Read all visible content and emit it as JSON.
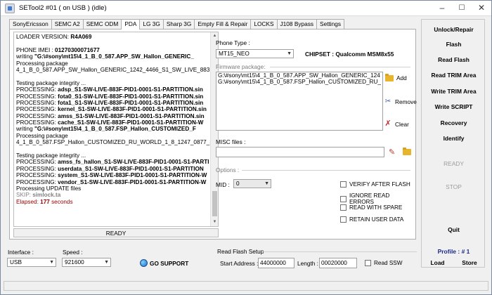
{
  "window": {
    "title": "SETool2 #01 ( on USB ) (idle)"
  },
  "tabs": [
    "SonyEricsson",
    "SEMC A2",
    "SEMC ODM",
    "PDA",
    "LG 3G",
    "Sharp 3G",
    "Empty Fill & Repair",
    "LOCKS",
    "J108 Bypass",
    "Settings"
  ],
  "log": {
    "lines": [
      [
        {
          "t": "LOADER VERSION: "
        },
        {
          "t": "R4A069",
          "c": "b"
        }
      ],
      [],
      [
        {
          "t": "PHONE IMEI : "
        },
        {
          "t": "01270300071677",
          "c": "b"
        }
      ],
      [
        {
          "t": "writing "
        },
        {
          "t": "\"G:\\#sony\\mt15\\4_1_B_0_587.APP_SW_Hallon_GENERIC_",
          "c": "b"
        }
      ],
      [
        {
          "t": "Processing package"
        }
      ],
      [
        {
          "t": "4_1_B_0_587.APP_SW_Hallon_GENERIC_1242_4466_S1_SW_LIVE_883F"
        }
      ],
      [],
      [
        {
          "t": "Testing package integrity ..."
        }
      ],
      [
        {
          "t": "PROCESSING: "
        },
        {
          "t": "adsp_S1-SW-LIVE-883F-PID1-0001-S1-PARTITION.sin",
          "c": "b"
        }
      ],
      [
        {
          "t": "PROCESSING: "
        },
        {
          "t": "fota0_S1-SW-LIVE-883F-PID1-0001-S1-PARTITION.sin",
          "c": "b"
        }
      ],
      [
        {
          "t": "PROCESSING: "
        },
        {
          "t": "fota1_S1-SW-LIVE-883F-PID1-0001-S1-PARTITION.sin",
          "c": "b"
        }
      ],
      [
        {
          "t": "PROCESSING: "
        },
        {
          "t": "kernel_S1-SW-LIVE-883F-PID1-0001-S1-PARTITION.sin",
          "c": "b"
        }
      ],
      [
        {
          "t": "PROCESSING: "
        },
        {
          "t": "amss_S1-SW-LIVE-883F-PID1-0001-S1-PARTITION.sin",
          "c": "b"
        }
      ],
      [
        {
          "t": "PROCESSING: "
        },
        {
          "t": "cache_S1-SW-LIVE-883F-PID1-0001-S1-PARTITION-W",
          "c": "b"
        }
      ],
      [
        {
          "t": "writing "
        },
        {
          "t": "\"G:\\#sony\\mt15\\4_1_B_0_587.FSP_Hallon_CUSTOMIZED_F",
          "c": "b"
        }
      ],
      [
        {
          "t": "Processing package"
        }
      ],
      [
        {
          "t": "4_1_B_0_587.FSP_Hallon_CUSTOMIZED_RU_WORLD_1_8_1247_0877_S1"
        }
      ],
      [],
      [
        {
          "t": "Testing package integrity ..."
        }
      ],
      [
        {
          "t": "PROCESSING: "
        },
        {
          "t": "amss_fs_hallon_S1-SW-LIVE-883F-PID1-0001-S1-PARTI",
          "c": "b"
        }
      ],
      [
        {
          "t": "PROCESSING: "
        },
        {
          "t": "userdata_S1-SW-LIVE-883F-PID1-0001-S1-PARTITION",
          "c": "b"
        }
      ],
      [
        {
          "t": "PROCESSING: "
        },
        {
          "t": "system_S1-SW-LIVE-883F-PID1-0001-S1-PARTITION-W",
          "c": "b"
        }
      ],
      [
        {
          "t": "PROCESSING: "
        },
        {
          "t": "vendor_S1-SW-LIVE-883F-PID1-0001-S1-PARTITION-W",
          "c": "b"
        }
      ],
      [
        {
          "t": "Processing UPDATE files"
        }
      ],
      [
        {
          "t": "SKIP: ",
          "c": "gray"
        },
        {
          "t": "simlock.ta",
          "c": "gray b"
        }
      ],
      [
        {
          "t": "Elapsed: ",
          "c": "red"
        },
        {
          "t": "177",
          "c": "red b"
        },
        {
          "t": " seconds",
          "c": "red"
        }
      ]
    ],
    "status": "READY"
  },
  "phone_type": {
    "label": "Phone Type :",
    "value": "MT15_NEO"
  },
  "chipset": "CHIPSET : Qualcomm MSM8x55",
  "firmware": {
    "title": "Firmware package:",
    "files": [
      "G:\\#sony\\mt15\\4_1_B_0_587.APP_SW_Hallon_GENERIC_124",
      "G:\\#sony\\mt15\\4_1_B_0_587.FSP_Hallon_CUSTOMIZED_RU_"
    ],
    "add": "Add",
    "remove": "Remove",
    "clear": "Clear"
  },
  "misc": {
    "label": "MISC files :",
    "value": ""
  },
  "options": {
    "title": "Options :",
    "mid_label": "MID :",
    "mid_value": "0",
    "checks": [
      "VERIFY AFTER FLASH",
      "IGNORE READ ERRORS",
      "READ WITH SPARE",
      "RETAIN USER DATA"
    ]
  },
  "right_buttons": {
    "unlock": "Unlock/Repair",
    "flash": "Flash",
    "read_flash": "Read Flash",
    "read_trim": "Read TRIM Area",
    "write_trim": "Write TRIM Area",
    "write_script": "Write SCRIPT",
    "recovery": "Recovery",
    "identify": "Identify",
    "ready": "READY",
    "stop": "STOP",
    "quit": "Quit",
    "profile": "Profile :  # 1",
    "load": "Load",
    "store": "Store"
  },
  "interface": {
    "label": "Interface :",
    "value": "USB"
  },
  "speed": {
    "label": "Speed :",
    "value": "921600"
  },
  "go_support": "GO SUPPORT",
  "read_flash_setup": {
    "title": "Read Flash Setup",
    "start_label": "Start Address :",
    "start_value": "44000000",
    "length_label": "Length :",
    "length_value": "00020000",
    "read_ssw": "Read SSW"
  },
  "icons": {
    "window": "setool-app-icon",
    "minimize": "minimize-icon",
    "maximize": "maximize-icon",
    "close": "close-icon",
    "add": "folder-add-icon",
    "remove": "remove-icon",
    "clear": "clear-x-icon",
    "misc_edit": "pencil-icon",
    "misc_folder": "folder-icon",
    "support": "globe-icon"
  }
}
